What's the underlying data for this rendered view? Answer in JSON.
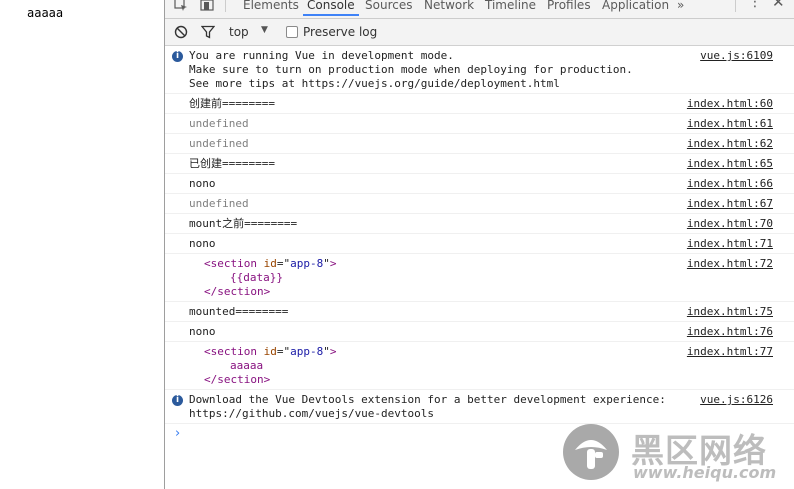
{
  "page": {
    "text": "aaaaa"
  },
  "tabs": [
    {
      "label": "Elements",
      "active": false
    },
    {
      "label": "Console",
      "active": true
    },
    {
      "label": "Sources",
      "active": false
    },
    {
      "label": "Network",
      "active": false
    },
    {
      "label": "Timeline",
      "active": false
    },
    {
      "label": "Profiles",
      "active": false
    },
    {
      "label": "Application",
      "active": false
    }
  ],
  "tabbar": {
    "more": "»",
    "menu": "⋮",
    "close": "✕"
  },
  "toolbar": {
    "context": "top",
    "preserve_log": "Preserve log",
    "preserve_checked": false
  },
  "messages": [
    {
      "kind": "info",
      "lines": [
        "You are running Vue in development mode.",
        "Make sure to turn on production mode when deploying for production.",
        "See more tips at https://vuejs.org/guide/deployment.html"
      ],
      "source": "vue.js:6109"
    },
    {
      "kind": "log",
      "text": "创建前========",
      "source": "index.html:60"
    },
    {
      "kind": "gray",
      "text": "undefined",
      "source": "index.html:61"
    },
    {
      "kind": "gray",
      "text": "undefined",
      "source": "index.html:62"
    },
    {
      "kind": "log",
      "text": "已创建========",
      "source": "index.html:65"
    },
    {
      "kind": "log",
      "text": "nono",
      "source": "index.html:66"
    },
    {
      "kind": "gray",
      "text": "undefined",
      "source": "index.html:67"
    },
    {
      "kind": "log",
      "text": "mount之前========",
      "source": "index.html:70"
    },
    {
      "kind": "log",
      "text": "nono",
      "source": "index.html:71"
    },
    {
      "kind": "node",
      "tag": "section",
      "attr": "id",
      "value": "app-8",
      "inner": "{{data}}",
      "source": "index.html:72"
    },
    {
      "kind": "log",
      "text": "mounted========",
      "source": "index.html:75"
    },
    {
      "kind": "log",
      "text": "nono",
      "source": "index.html:76"
    },
    {
      "kind": "node",
      "tag": "section",
      "attr": "id",
      "value": "app-8",
      "inner": "aaaaa",
      "source": "index.html:77"
    },
    {
      "kind": "info",
      "lines": [
        "Download the Vue Devtools extension for a better development experience:",
        "https://github.com/vuejs/vue-devtools"
      ],
      "source": "vue.js:6126"
    }
  ],
  "prompt": "›",
  "watermark": {
    "title": "黑区网络",
    "url": "www.heiqu.com"
  },
  "colors": {
    "accent": "#3e82f7",
    "info": "#2b5a9c",
    "tag": "#881280",
    "attr_name": "#994500",
    "attr_value": "#1a1aa6"
  }
}
